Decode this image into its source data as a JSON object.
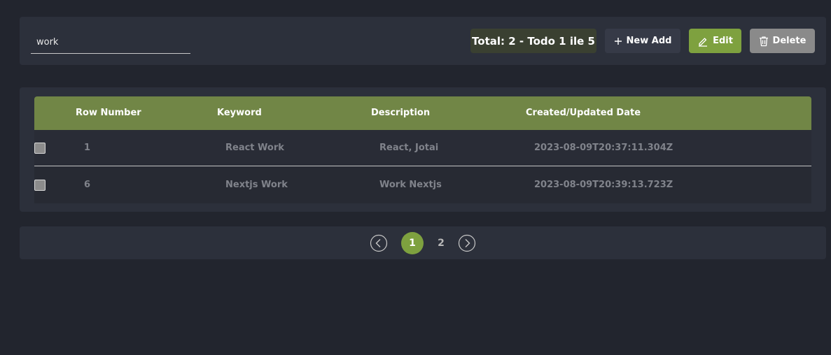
{
  "search": {
    "value": "work",
    "placeholder": ""
  },
  "summary": {
    "total_text": "Total: 2 - Todo 1 ile 5"
  },
  "toolbar": {
    "new_label": "New Add",
    "edit_label": "Edit",
    "delete_label": "Delete"
  },
  "table": {
    "headers": {
      "row_number": "Row Number",
      "keyword": "Keyword",
      "description": "Description",
      "date": "Created/Updated Date"
    },
    "rows": [
      {
        "row_number": "1",
        "keyword": "React Work",
        "description": "React, Jotai",
        "date": "2023-08-09T20:37:11.304Z"
      },
      {
        "row_number": "6",
        "keyword": "Nextjs Work",
        "description": "Work Nextjs",
        "date": "2023-08-09T20:39:13.723Z"
      }
    ]
  },
  "pagination": {
    "pages": [
      "1",
      "2"
    ],
    "current": "1"
  },
  "colors": {
    "accent": "#7ea13f",
    "header": "#718646",
    "background": "#22252e",
    "card": "#2c303b",
    "delete": "#8a8a8a"
  },
  "icons": {
    "new": "plus-icon",
    "edit": "pencil-icon",
    "delete": "trash-icon",
    "prev": "chevron-left-circle-icon",
    "next": "chevron-right-circle-icon"
  }
}
